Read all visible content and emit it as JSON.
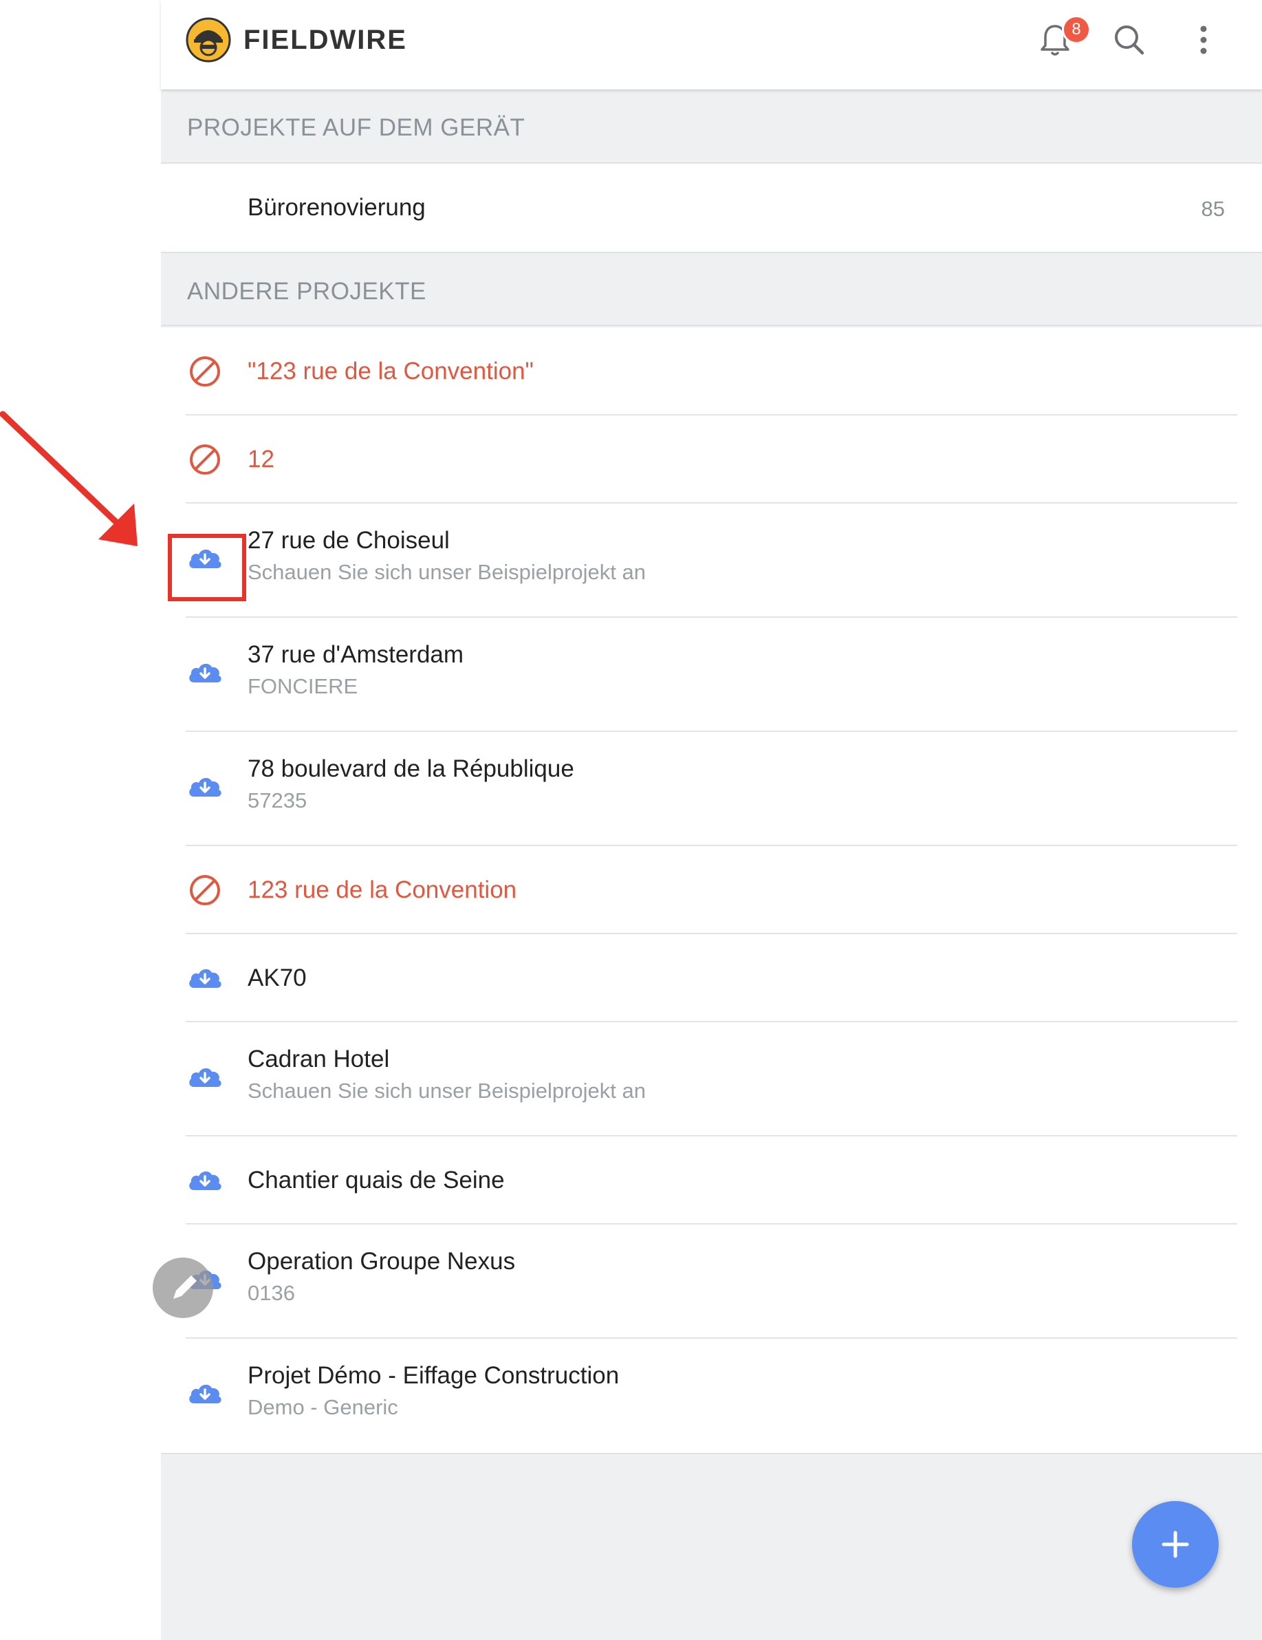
{
  "header": {
    "brand": "FIELDWIRE",
    "notification_count": "8"
  },
  "sections": {
    "on_device_title": "PROJEKTE AUF DEM GERÄT",
    "other_title": "ANDERE PROJEKTE"
  },
  "device_projects": [
    {
      "title": "Bürorenovierung",
      "count": "85"
    }
  ],
  "other_projects": [
    {
      "title": "\"123 rue de la Convention\"",
      "subtitle": "",
      "status": "blocked"
    },
    {
      "title": "12",
      "subtitle": "",
      "status": "blocked"
    },
    {
      "title": "27 rue de Choiseul",
      "subtitle": "Schauen Sie sich unser Beispielprojekt an",
      "status": "download"
    },
    {
      "title": "37 rue d'Amsterdam",
      "subtitle": "FONCIERE",
      "status": "download"
    },
    {
      "title": "78 boulevard de la République",
      "subtitle": "57235",
      "status": "download"
    },
    {
      "title": "123 rue de la Convention",
      "subtitle": "",
      "status": "blocked"
    },
    {
      "title": "AK70",
      "subtitle": "",
      "status": "download"
    },
    {
      "title": "Cadran Hotel",
      "subtitle": "Schauen Sie sich unser Beispielprojekt an",
      "status": "download"
    },
    {
      "title": "Chantier quais de Seine",
      "subtitle": "",
      "status": "download"
    },
    {
      "title": "Operation Groupe Nexus",
      "subtitle": "0136",
      "status": "download"
    },
    {
      "title": "Projet Démo - Eiffage Construction",
      "subtitle": "Demo - Generic",
      "status": "download"
    }
  ],
  "colors": {
    "accent_blue": "#5b8cf2",
    "blocked_red": "#e0583f",
    "annotation_red": "#e8332a",
    "logo_yellow": "#f5b82e"
  }
}
